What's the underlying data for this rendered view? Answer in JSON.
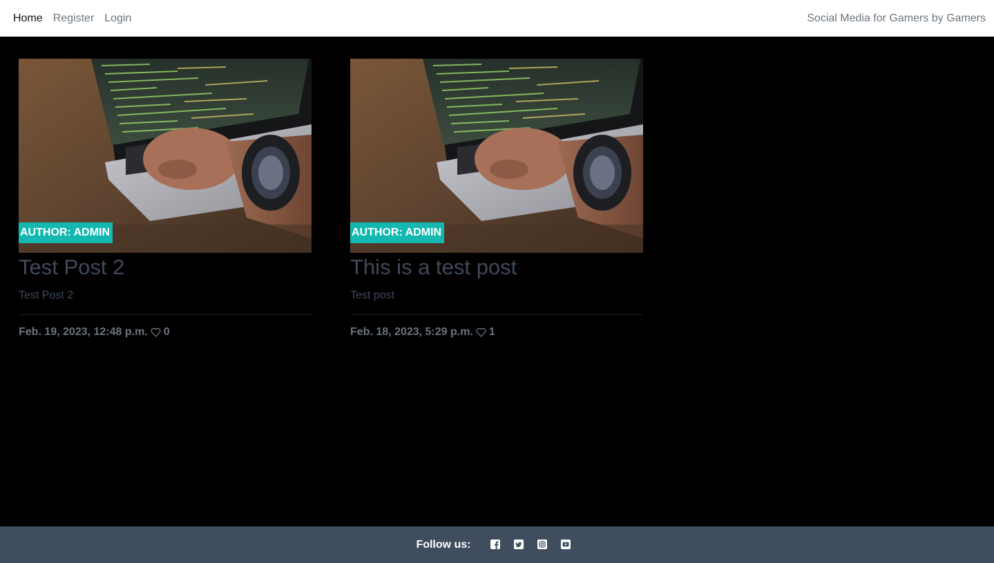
{
  "nav": {
    "links": [
      "Home",
      "Register",
      "Login"
    ],
    "tagline": "Social Media for Gamers by Gamers"
  },
  "posts": [
    {
      "author_badge": "AUTHOR: ADMIN",
      "title": "Test Post 2",
      "excerpt": "Test Post 2",
      "date": "Feb. 19, 2023, 12:48 p.m.",
      "likes": "0"
    },
    {
      "author_badge": "AUTHOR: ADMIN",
      "title": "This is a test post",
      "excerpt": "Test post",
      "date": "Feb. 18, 2023, 5:29 p.m.",
      "likes": "1"
    }
  ],
  "footer": {
    "follow_label": "Follow us:",
    "icons": [
      "facebook-icon",
      "twitter-icon",
      "instagram-icon",
      "youtube-icon"
    ]
  },
  "colors": {
    "badge": "#14b8b0",
    "footer_bg": "#3f4d5e",
    "title_text": "#3f4a5a"
  }
}
